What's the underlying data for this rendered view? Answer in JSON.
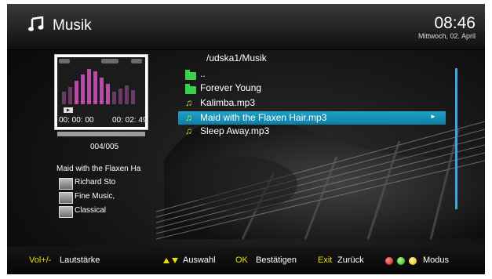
{
  "header": {
    "title": "Musik",
    "time": "08:46",
    "date": "Mittwoch, 02. April"
  },
  "player": {
    "elapsed": "00: 00: 00",
    "total": "00: 02: 49",
    "track_counter": "004/005",
    "song": "Maid with the Flaxen Ha",
    "artist": "Richard Sto",
    "album": "Fine Music,",
    "genre": "Classical"
  },
  "browser": {
    "path": "/udska1/Musik",
    "items": [
      {
        "label": "..",
        "type": "folder"
      },
      {
        "label": "Forever Young",
        "type": "folder"
      },
      {
        "label": "Kalimba.mp3",
        "type": "file"
      },
      {
        "label": "Maid with the Flaxen Hair.mp3",
        "type": "file",
        "selected": true
      },
      {
        "label": "Sleep Away.mp3",
        "type": "file"
      }
    ]
  },
  "footer": {
    "vol_key": "Vol+/-",
    "vol_label": "Lautstärke",
    "nav_label": "Auswahl",
    "ok_key": "OK",
    "ok_label": "Bestätigen",
    "exit_key": "Exit",
    "exit_label": "Zurück",
    "mode_label": "Modus"
  },
  "colors": {
    "accent": "#1ea2c8",
    "footer_key": "#e8e000",
    "folder": "#3bd04a",
    "note": "#c8e83a"
  }
}
